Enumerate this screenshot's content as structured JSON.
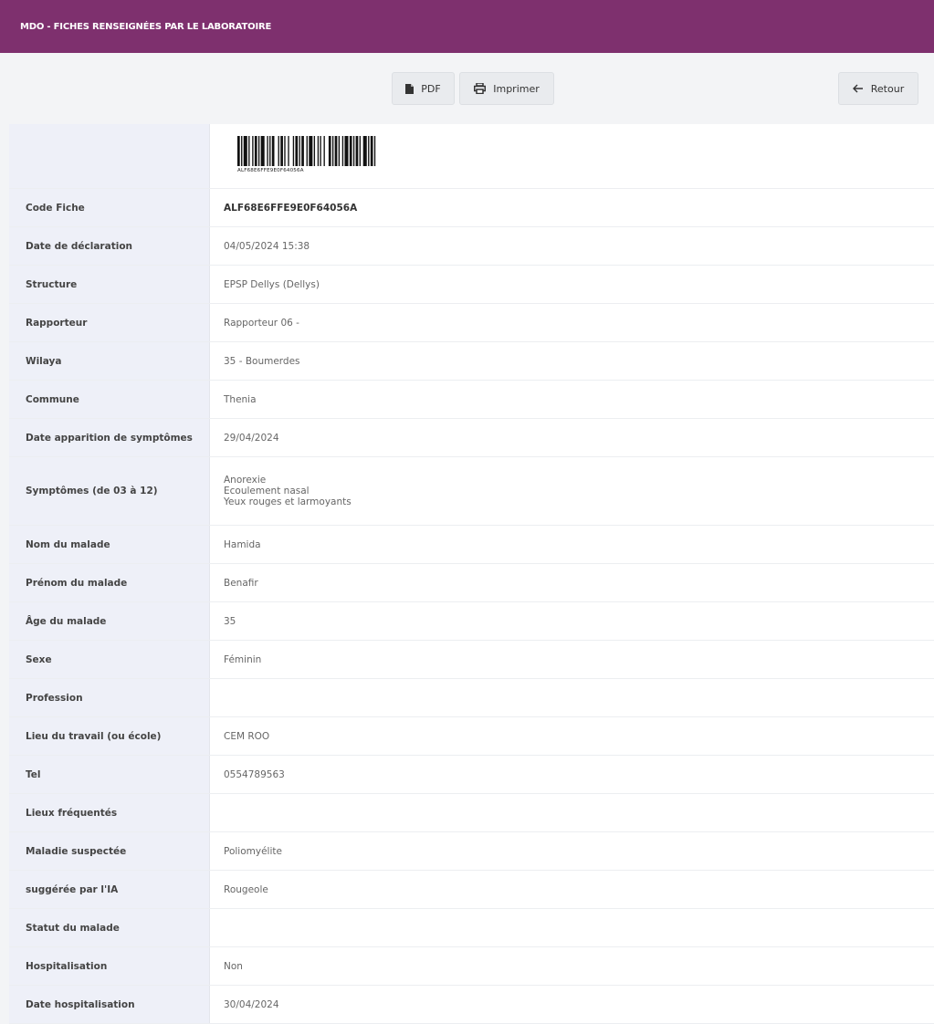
{
  "header": {
    "title": "MDO - FICHES RENSEIGNÉES PAR LE LABORATOIRE"
  },
  "toolbar": {
    "pdf_label": "PDF",
    "print_label": "Imprimer",
    "back_label": "Retour"
  },
  "barcode": {
    "text": "ALF68E6FFE9E0F64056A"
  },
  "rows": [
    {
      "label": "Code Fiche",
      "value": "ALF68E6FFE9E0F64056A"
    },
    {
      "label": "Date de déclaration",
      "value": "04/05/2024 15:38"
    },
    {
      "label": "Structure",
      "value": "EPSP Dellys (Dellys)"
    },
    {
      "label": "Rapporteur",
      "value": "Rapporteur 06 -"
    },
    {
      "label": "Wilaya",
      "value": "35 - Boumerdes"
    },
    {
      "label": "Commune",
      "value": "Thenia"
    },
    {
      "label": "Date apparition de symptômes",
      "value": "29/04/2024"
    },
    {
      "label": "Symptômes (de 03 à 12)",
      "values": [
        "Anorexie",
        "Ecoulement nasal",
        "Yeux rouges et larmoyants"
      ]
    },
    {
      "label": "Nom du malade",
      "value": "Hamida"
    },
    {
      "label": "Prénom du malade",
      "value": "Benafir"
    },
    {
      "label": "Âge du malade",
      "value": "35"
    },
    {
      "label": "Sexe",
      "value": "Féminin"
    },
    {
      "label": "Profession",
      "value": ""
    },
    {
      "label": "Lieu du travail (ou école)",
      "value": "CEM ROO"
    },
    {
      "label": "Tel",
      "value": "0554789563"
    },
    {
      "label": "Lieux fréquentés",
      "value": ""
    },
    {
      "label": "Maladie suspectée",
      "value": "Poliomyélite"
    },
    {
      "label": "suggérée par l'IA",
      "value": "Rougeole"
    },
    {
      "label": "Statut du malade",
      "value": ""
    },
    {
      "label": "Hospitalisation",
      "value": "Non"
    },
    {
      "label": "Date hospitalisation",
      "value": "30/04/2024"
    }
  ]
}
